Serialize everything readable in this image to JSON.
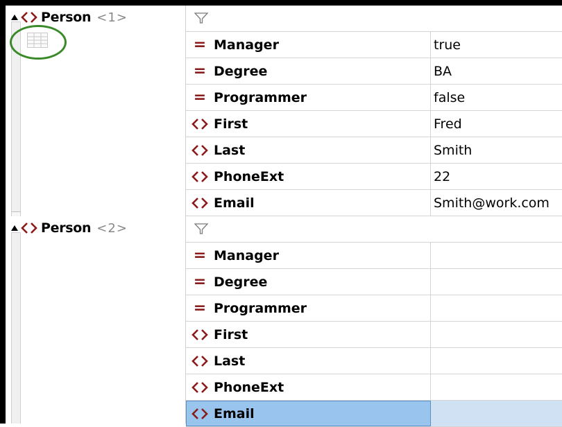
{
  "colors": {
    "element_icon": "#8b1a1a",
    "attr_icon": "#8b1a1a",
    "ellipse": "#3a8a2a",
    "selection": "#99c4ee",
    "selection_value": "#cfe1f3"
  },
  "icons": {
    "attribute": "=",
    "element": "element-brackets-icon",
    "filter": "filter-icon",
    "grid": "table-view-icon",
    "collapse": "triangle-up-icon"
  },
  "persons": [
    {
      "name": "Person",
      "index": "<1>",
      "rows": [
        {
          "kind": "attr",
          "name": "Manager",
          "value": "true"
        },
        {
          "kind": "attr",
          "name": "Degree",
          "value": "BA"
        },
        {
          "kind": "attr",
          "name": "Programmer",
          "value": "false"
        },
        {
          "kind": "elem",
          "name": "First",
          "value": "Fred"
        },
        {
          "kind": "elem",
          "name": "Last",
          "value": "Smith"
        },
        {
          "kind": "elem",
          "name": "PhoneExt",
          "value": "22"
        },
        {
          "kind": "elem",
          "name": "Email",
          "value": "Smith@work.com"
        }
      ]
    },
    {
      "name": "Person",
      "index": "<2>",
      "rows": [
        {
          "kind": "attr",
          "name": "Manager",
          "value": ""
        },
        {
          "kind": "attr",
          "name": "Degree",
          "value": ""
        },
        {
          "kind": "attr",
          "name": "Programmer",
          "value": ""
        },
        {
          "kind": "elem",
          "name": "First",
          "value": ""
        },
        {
          "kind": "elem",
          "name": "Last",
          "value": ""
        },
        {
          "kind": "elem",
          "name": "PhoneExt",
          "value": ""
        },
        {
          "kind": "elem",
          "name": "Email",
          "value": "",
          "selected": true
        }
      ]
    }
  ]
}
